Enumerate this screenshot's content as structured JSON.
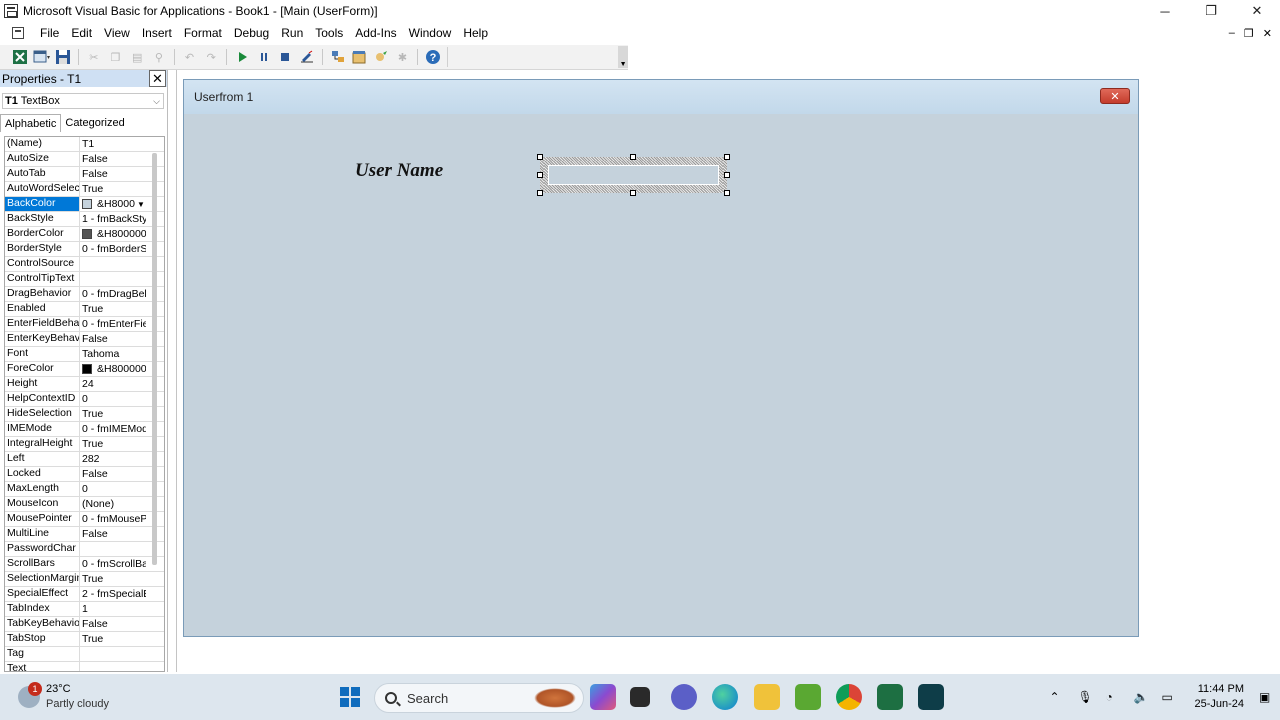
{
  "window": {
    "title": "Microsoft Visual Basic for Applications - Book1 - [Main (UserForm)]",
    "minimize_glyph": "─",
    "maximize_glyph": "❐",
    "close_glyph": "✕"
  },
  "menu": {
    "items": [
      {
        "label": "File"
      },
      {
        "label": "Edit"
      },
      {
        "label": "View"
      },
      {
        "label": "Insert"
      },
      {
        "label": "Format"
      },
      {
        "label": "Debug"
      },
      {
        "label": "Run"
      },
      {
        "label": "Tools"
      },
      {
        "label": "Add-Ins"
      },
      {
        "label": "Window"
      },
      {
        "label": "Help"
      }
    ],
    "mdi_min": "‒",
    "mdi_restore": "❐",
    "mdi_close": "✕"
  },
  "properties": {
    "title": "Properties - T1",
    "object_name": "T1",
    "object_type": "TextBox",
    "tabs": [
      "Alphabetic",
      "Categorized"
    ],
    "rows": [
      {
        "name": "(Name)",
        "value": "T1"
      },
      {
        "name": "AutoSize",
        "value": "False"
      },
      {
        "name": "AutoTab",
        "value": "False"
      },
      {
        "name": "AutoWordSelect",
        "value": "True"
      },
      {
        "name": "BackColor",
        "value": "&H8000",
        "swatch": "#c5d2dc",
        "selected": true
      },
      {
        "name": "BackStyle",
        "value": "1 - fmBackStyle"
      },
      {
        "name": "BorderColor",
        "value": "&H8000000",
        "swatch": "#555555"
      },
      {
        "name": "BorderStyle",
        "value": "0 - fmBorderSt"
      },
      {
        "name": "ControlSource",
        "value": ""
      },
      {
        "name": "ControlTipText",
        "value": ""
      },
      {
        "name": "DragBehavior",
        "value": "0 - fmDragBeh"
      },
      {
        "name": "Enabled",
        "value": "True"
      },
      {
        "name": "EnterFieldBehavior",
        "value": "0 - fmEnterFiel"
      },
      {
        "name": "EnterKeyBehavior",
        "value": "False"
      },
      {
        "name": "Font",
        "value": "Tahoma"
      },
      {
        "name": "ForeColor",
        "value": "&H8000000",
        "swatch": "#000000"
      },
      {
        "name": "Height",
        "value": "24"
      },
      {
        "name": "HelpContextID",
        "value": "0"
      },
      {
        "name": "HideSelection",
        "value": "True"
      },
      {
        "name": "IMEMode",
        "value": "0 - fmIMEMode"
      },
      {
        "name": "IntegralHeight",
        "value": "True"
      },
      {
        "name": "Left",
        "value": "282"
      },
      {
        "name": "Locked",
        "value": "False"
      },
      {
        "name": "MaxLength",
        "value": "0"
      },
      {
        "name": "MouseIcon",
        "value": "(None)"
      },
      {
        "name": "MousePointer",
        "value": "0 - fmMousePo"
      },
      {
        "name": "MultiLine",
        "value": "False"
      },
      {
        "name": "PasswordChar",
        "value": ""
      },
      {
        "name": "ScrollBars",
        "value": "0 - fmScrollBar"
      },
      {
        "name": "SelectionMargin",
        "value": "True"
      },
      {
        "name": "SpecialEffect",
        "value": "2 - fmSpecialEf"
      },
      {
        "name": "TabIndex",
        "value": "1"
      },
      {
        "name": "TabKeyBehavior",
        "value": "False"
      },
      {
        "name": "TabStop",
        "value": "True"
      },
      {
        "name": "Tag",
        "value": ""
      },
      {
        "name": "Text",
        "value": ""
      }
    ]
  },
  "userform": {
    "caption": "Userfrom 1",
    "label_text": "User Name",
    "close_glyph": "✕"
  },
  "taskbar": {
    "temperature": "23°C",
    "weather": "Partly cloudy",
    "weather_badge": "1",
    "search_placeholder": "Search",
    "time": "11:44 PM",
    "date": "25-Jun-24"
  }
}
